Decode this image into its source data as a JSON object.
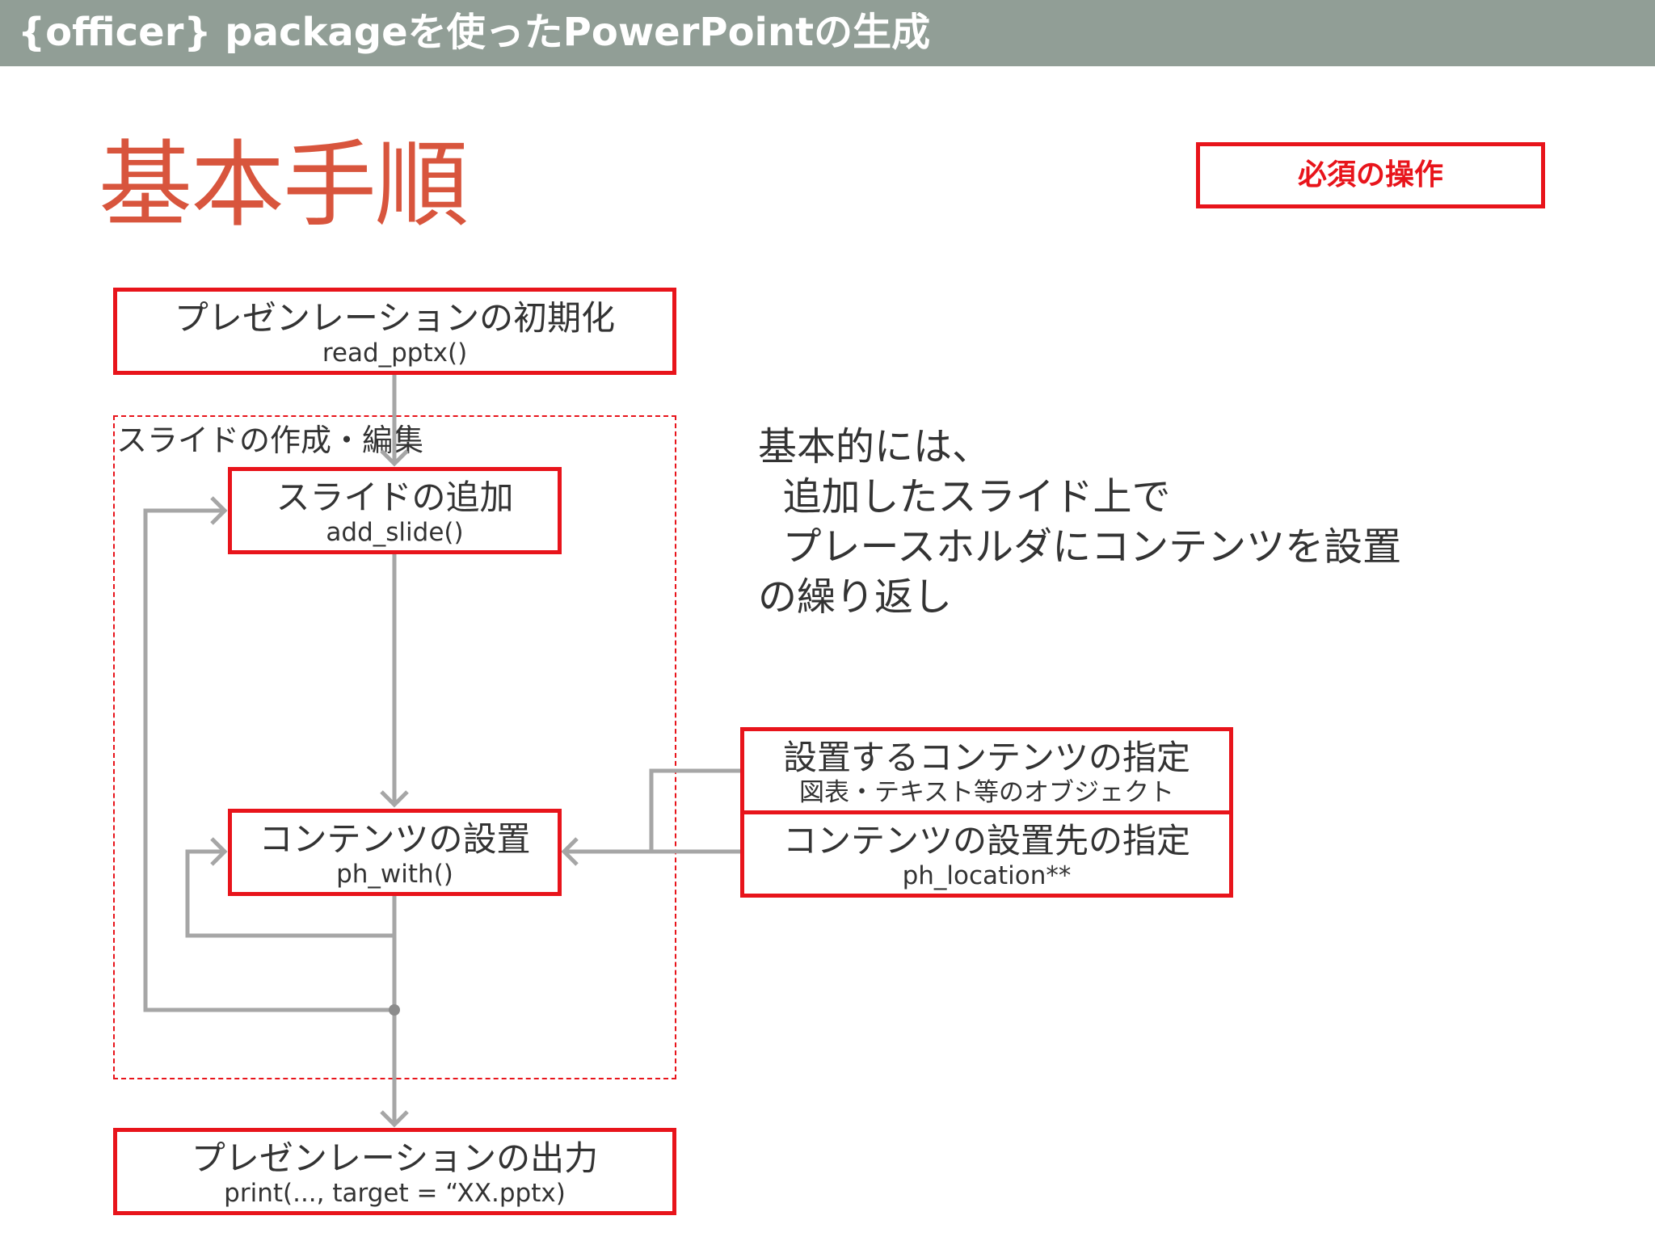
{
  "header": {
    "title": "{officer} packageを使ったPowerPointの生成"
  },
  "main_title": "基本手順",
  "legend": {
    "label": "必須の操作"
  },
  "region": {
    "label": "スライドの作成・編集"
  },
  "steps": {
    "init": {
      "title": "プレゼンレーションの初期化",
      "code": "read_pptx()"
    },
    "add_slide": {
      "title": "スライドの追加",
      "code": "add_slide()"
    },
    "place": {
      "title": "コンテンツの設置",
      "code": "ph_with()"
    },
    "output": {
      "title": "プレゼンレーションの出力",
      "code": "print(..., target = “XX.pptx)"
    }
  },
  "inputs": {
    "content": {
      "title": "設置するコンテンツの指定",
      "sub": "図表・テキスト等のオブジェクト"
    },
    "location": {
      "title": "コンテンツの設置先の指定",
      "sub": "ph_location**"
    }
  },
  "note": {
    "lines": [
      "基本的には、",
      "  追加したスライド上で",
      "  プレースホルダにコンテンツを設置",
      "の繰り返し"
    ]
  },
  "colors": {
    "header_bg": "#919e96",
    "accent_red": "#e8141b",
    "title_orange": "#d8553d",
    "connector_gray": "#a6a6a6"
  }
}
